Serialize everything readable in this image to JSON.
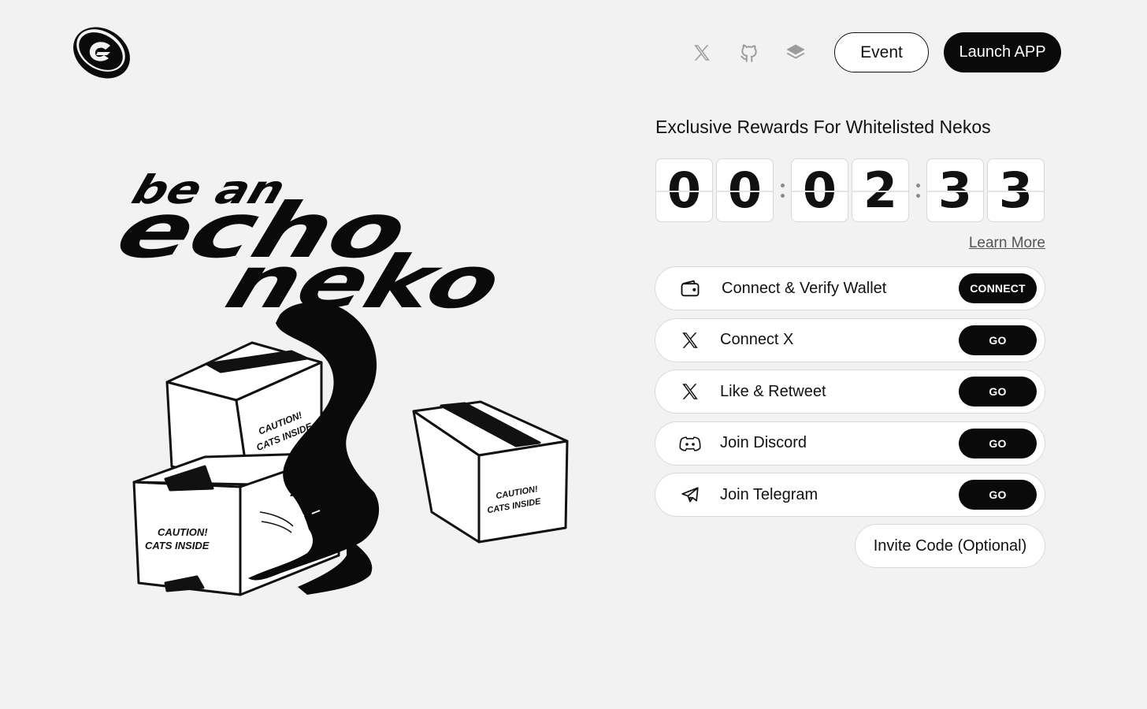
{
  "header": {
    "logo_icon": "echo-logo-icon",
    "social_icons": [
      "x-icon",
      "github-icon",
      "stack-icon"
    ],
    "event_label": "Event",
    "launch_label": "Launch APP"
  },
  "hero": {
    "line1": "be an",
    "line2": "echo",
    "line3": "neko",
    "box_label_1": "CAUTION!",
    "box_label_2": "CATS INSIDE"
  },
  "rewards": {
    "title": "Exclusive Rewards For Whitelisted Nekos",
    "countdown": [
      "0",
      "0",
      "0",
      "2",
      "3",
      "3"
    ],
    "learn_more": "Learn More"
  },
  "tasks": [
    {
      "icon": "wallet-icon",
      "label": "Connect & Verify Wallet",
      "button": "CONNECT"
    },
    {
      "icon": "x-icon",
      "label": "Connect X",
      "button": "GO"
    },
    {
      "icon": "x-icon",
      "label": "Like & Retweet",
      "button": "GO"
    },
    {
      "icon": "discord-icon",
      "label": "Join Discord",
      "button": "GO"
    },
    {
      "icon": "telegram-icon",
      "label": "Join Telegram",
      "button": "GO"
    }
  ],
  "invite_label": "Invite Code (Optional)"
}
